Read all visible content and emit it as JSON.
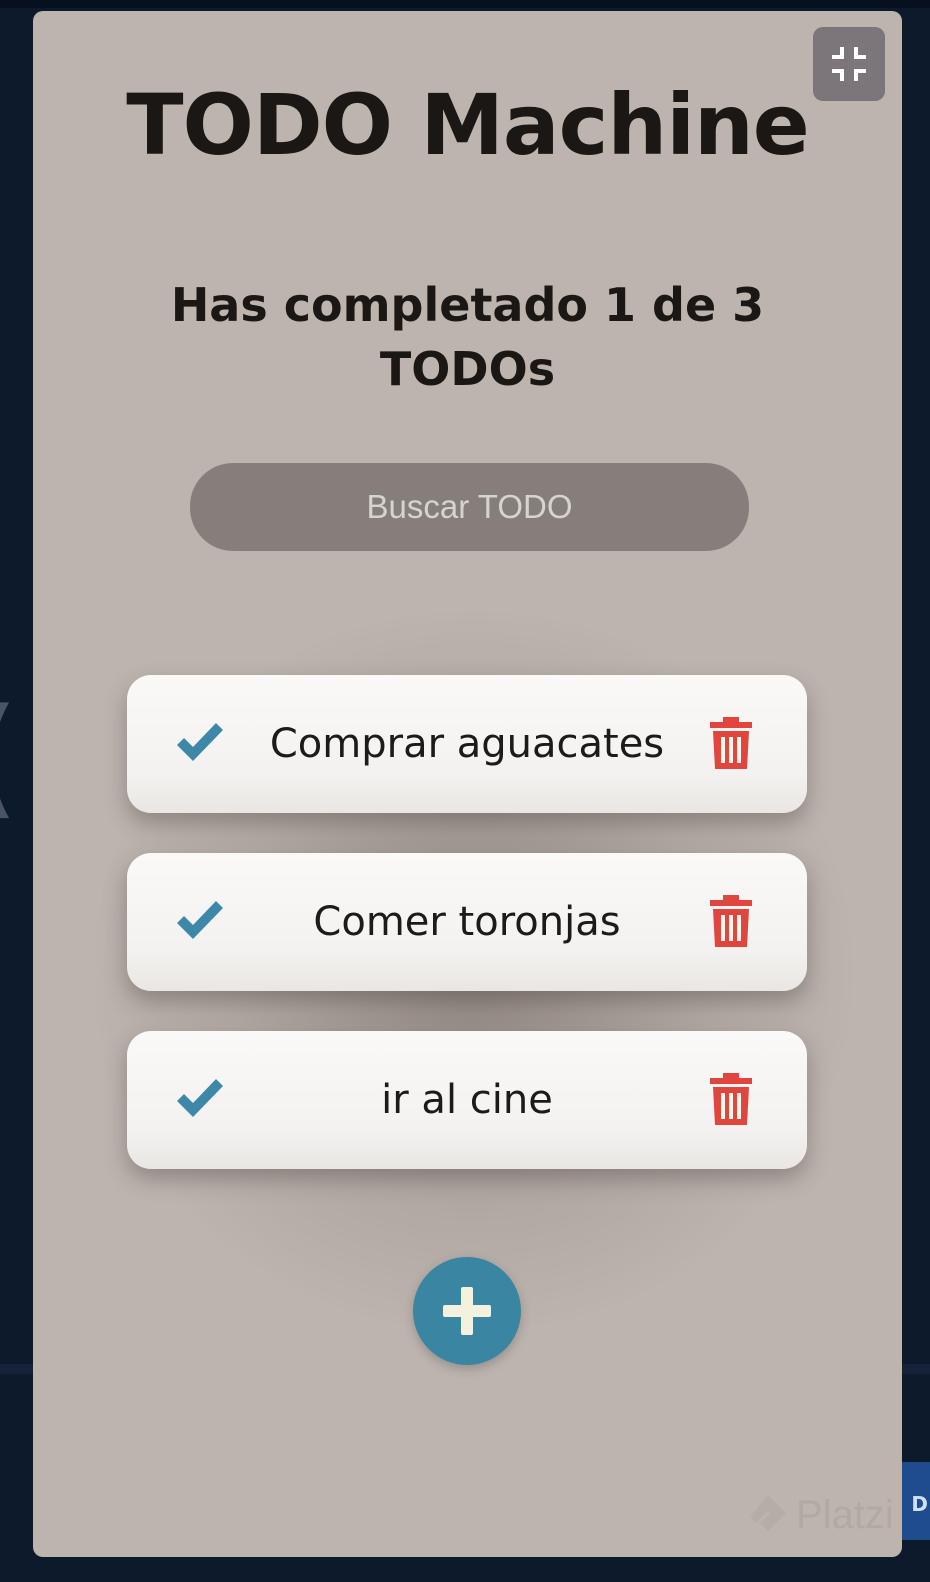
{
  "app": {
    "title": "TODO Machine",
    "counter_text": "Has completado 1 de 3 TODOs"
  },
  "search": {
    "placeholder": "Buscar TODO",
    "value": ""
  },
  "todos": [
    {
      "text": "Comprar aguacates",
      "completed": false
    },
    {
      "text": "Comer toronjas",
      "completed": false
    },
    {
      "text": "ir al cine",
      "completed": false
    }
  ],
  "icons": {
    "check": "check-icon",
    "delete": "trash-icon",
    "add": "plus-icon",
    "exit_fullscreen": "exit-fullscreen-icon"
  },
  "colors": {
    "check": "#3d87a8",
    "delete": "#e0463e",
    "add_button": "#3a85a1",
    "add_icon": "#f5f1df",
    "modal_bg": "#bdb4ae",
    "search_bg": "#867e7b"
  },
  "watermark": {
    "brand": "Platzi"
  },
  "background": {
    "side_label": "D"
  }
}
